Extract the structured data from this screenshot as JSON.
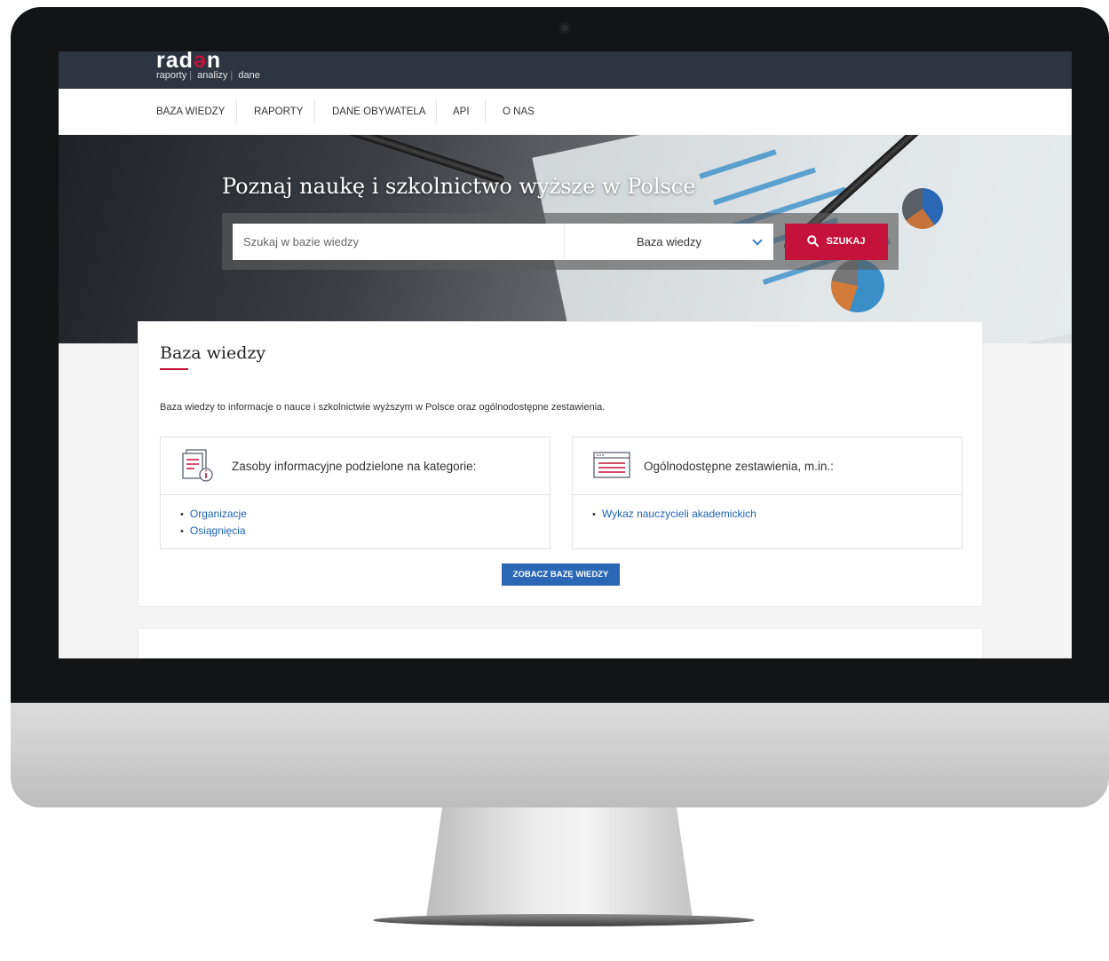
{
  "brand": {
    "logo_pre": "rad",
    "logo_accent": "ə",
    "logo_post": "n",
    "tagline": [
      "raporty",
      "analizy",
      "dane"
    ]
  },
  "nav": {
    "items": [
      "BAZA WIEDZY",
      "RAPORTY",
      "DANE OBYWATELA",
      "API",
      "O NAS"
    ]
  },
  "hero": {
    "title": "Poznaj naukę i szkolnictwo wyższe w Polsce",
    "search_placeholder": "Szukaj w bazie wiedzy",
    "select_value": "Baza wiedzy",
    "search_button": "SZUKAJ"
  },
  "knowledge": {
    "title": "Baza wiedzy",
    "description": "Baza wiedzy to informacje o nauce i szkolnictwie wyższym w Polsce oraz ogólnodostępne zestawienia.",
    "boxes": [
      {
        "title": "Zasoby informacyjne podzielone na kategorie:",
        "links": [
          "Organizacje",
          "Osiągnięcia"
        ]
      },
      {
        "title": "Ogólnodostępne zestawienia, m.in.:",
        "links": [
          "Wykaz nauczycieli akademickich"
        ]
      }
    ],
    "cta": "ZOBACZ BAZĘ WIEDZY"
  },
  "colors": {
    "accent": "#c4123a",
    "link": "#1f63b5",
    "topbar": "#2e3541",
    "cta": "#2a67b5"
  }
}
